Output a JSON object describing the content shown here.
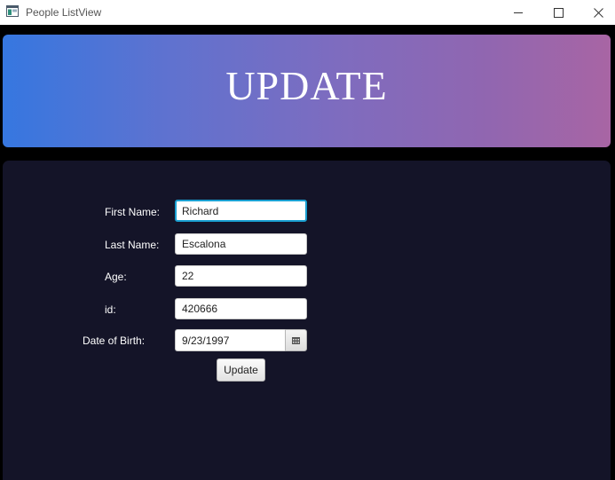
{
  "window": {
    "title": "People ListView",
    "app_icon": "app-window-icon",
    "controls": {
      "minimize_icon": "minimize-icon",
      "maximize_icon": "maximize-icon",
      "close_icon": "close-icon"
    }
  },
  "header": {
    "title": "UPDATE",
    "gradient_start": "#3677e0",
    "gradient_end": "#a865a4"
  },
  "form": {
    "background": "#141428",
    "fields": {
      "first_name": {
        "label": "First Name:",
        "value": "Richard"
      },
      "last_name": {
        "label": "Last Name:",
        "value": "Escalona"
      },
      "age": {
        "label": "Age:",
        "value": "22"
      },
      "id": {
        "label": "id:",
        "value": "420666"
      },
      "dob": {
        "label": "Date of Birth:",
        "value": "9/23/1997",
        "picker_icon": "calendar-icon"
      }
    },
    "submit_label": "Update",
    "focus_color": "#1a9fd1"
  }
}
